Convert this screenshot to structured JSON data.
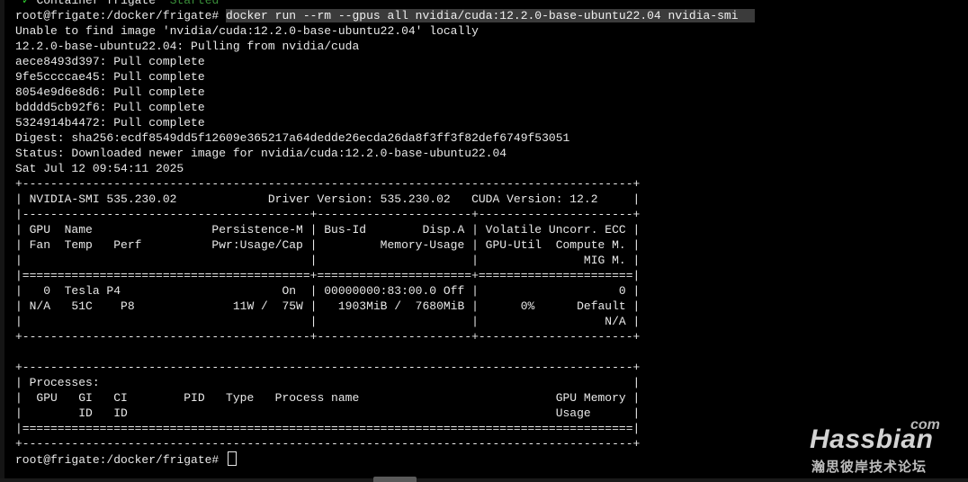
{
  "terminal": {
    "status_line": {
      "check": "✓",
      "name": "Container frigate",
      "state": "Started"
    },
    "prompt": "root@frigate:/docker/frigate# ",
    "command": "docker run --rm --gpus all nvidia/cuda:12.2.0-base-ubuntu22.04 nvidia-smi",
    "output": [
      "Unable to find image 'nvidia/cuda:12.2.0-base-ubuntu22.04' locally",
      "12.2.0-base-ubuntu22.04: Pulling from nvidia/cuda",
      "aece8493d397: Pull complete",
      "9fe5ccccae45: Pull complete",
      "8054e9d6e8d6: Pull complete",
      "bdddd5cb92f6: Pull complete",
      "5324914b4472: Pull complete",
      "Digest: sha256:ecdf8549dd5f12609e365217a64dedde26ecda26da8f3ff3f82def6749f53051",
      "Status: Downloaded newer image for nvidia/cuda:12.2.0-base-ubuntu22.04",
      "Sat Jul 12 09:54:11 2025",
      "+---------------------------------------------------------------------------------------+",
      "| NVIDIA-SMI 535.230.02             Driver Version: 535.230.02   CUDA Version: 12.2     |",
      "|-----------------------------------------+----------------------+----------------------+",
      "| GPU  Name                 Persistence-M | Bus-Id        Disp.A | Volatile Uncorr. ECC |",
      "| Fan  Temp   Perf          Pwr:Usage/Cap |         Memory-Usage | GPU-Util  Compute M. |",
      "|                                         |                      |               MIG M. |",
      "|=========================================+======================+======================|",
      "|   0  Tesla P4                       On  | 00000000:83:00.0 Off |                    0 |",
      "| N/A   51C    P8              11W /  75W |   1903MiB /  7680MiB |      0%      Default |",
      "|                                         |                      |                  N/A |",
      "+-----------------------------------------+----------------------+----------------------+",
      "",
      "+---------------------------------------------------------------------------------------+",
      "| Processes:                                                                            |",
      "|  GPU   GI   CI        PID   Type   Process name                            GPU Memory |",
      "|        ID   ID                                                             Usage      |",
      "|=======================================================================================|",
      "+---------------------------------------------------------------------------------------+"
    ],
    "final_prompt": "root@frigate:/docker/frigate# "
  },
  "watermark": {
    "com": "com",
    "name": "Hassbian",
    "subtitle": "瀚思彼岸技术论坛"
  }
}
